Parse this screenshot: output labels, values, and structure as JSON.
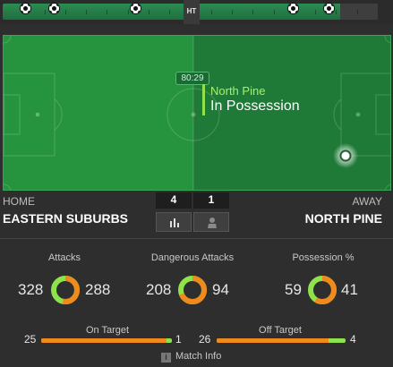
{
  "timeline": {
    "halftime_label": "HT",
    "elapsed_fraction": 0.9,
    "goal_icon": "soccer-ball-icon"
  },
  "pitch": {
    "clock": "80:29",
    "possession_team": "North Pine",
    "possession_label": "In Possession",
    "colors": {
      "home_half": "#26943f",
      "away_half": "#1f7a37",
      "highlight": "#8fe34a"
    }
  },
  "match": {
    "home_label": "HOME",
    "home_team": "EASTERN SUBURBS",
    "away_label": "AWAY",
    "away_team": "NORTH PINE",
    "home_score": "4",
    "away_score": "1",
    "stats_icon": "bar-chart-icon",
    "lineup_icon": "player-icon"
  },
  "stats": {
    "attacks": {
      "title": "Attacks",
      "home": "328",
      "away": "288"
    },
    "dangerous_attacks": {
      "title": "Dangerous Attacks",
      "home": "208",
      "away": "94"
    },
    "possession": {
      "title": "Possession %",
      "home": "59",
      "away": "41"
    },
    "on_target": {
      "title": "On Target",
      "home": "25",
      "away": "1"
    },
    "off_target": {
      "title": "Off Target",
      "home": "26",
      "away": "4"
    },
    "colors": {
      "home": "#f08a1c",
      "away": "#8fe34a"
    }
  },
  "footer": {
    "match_info_label": "Match Info",
    "info_icon": "info-icon"
  }
}
